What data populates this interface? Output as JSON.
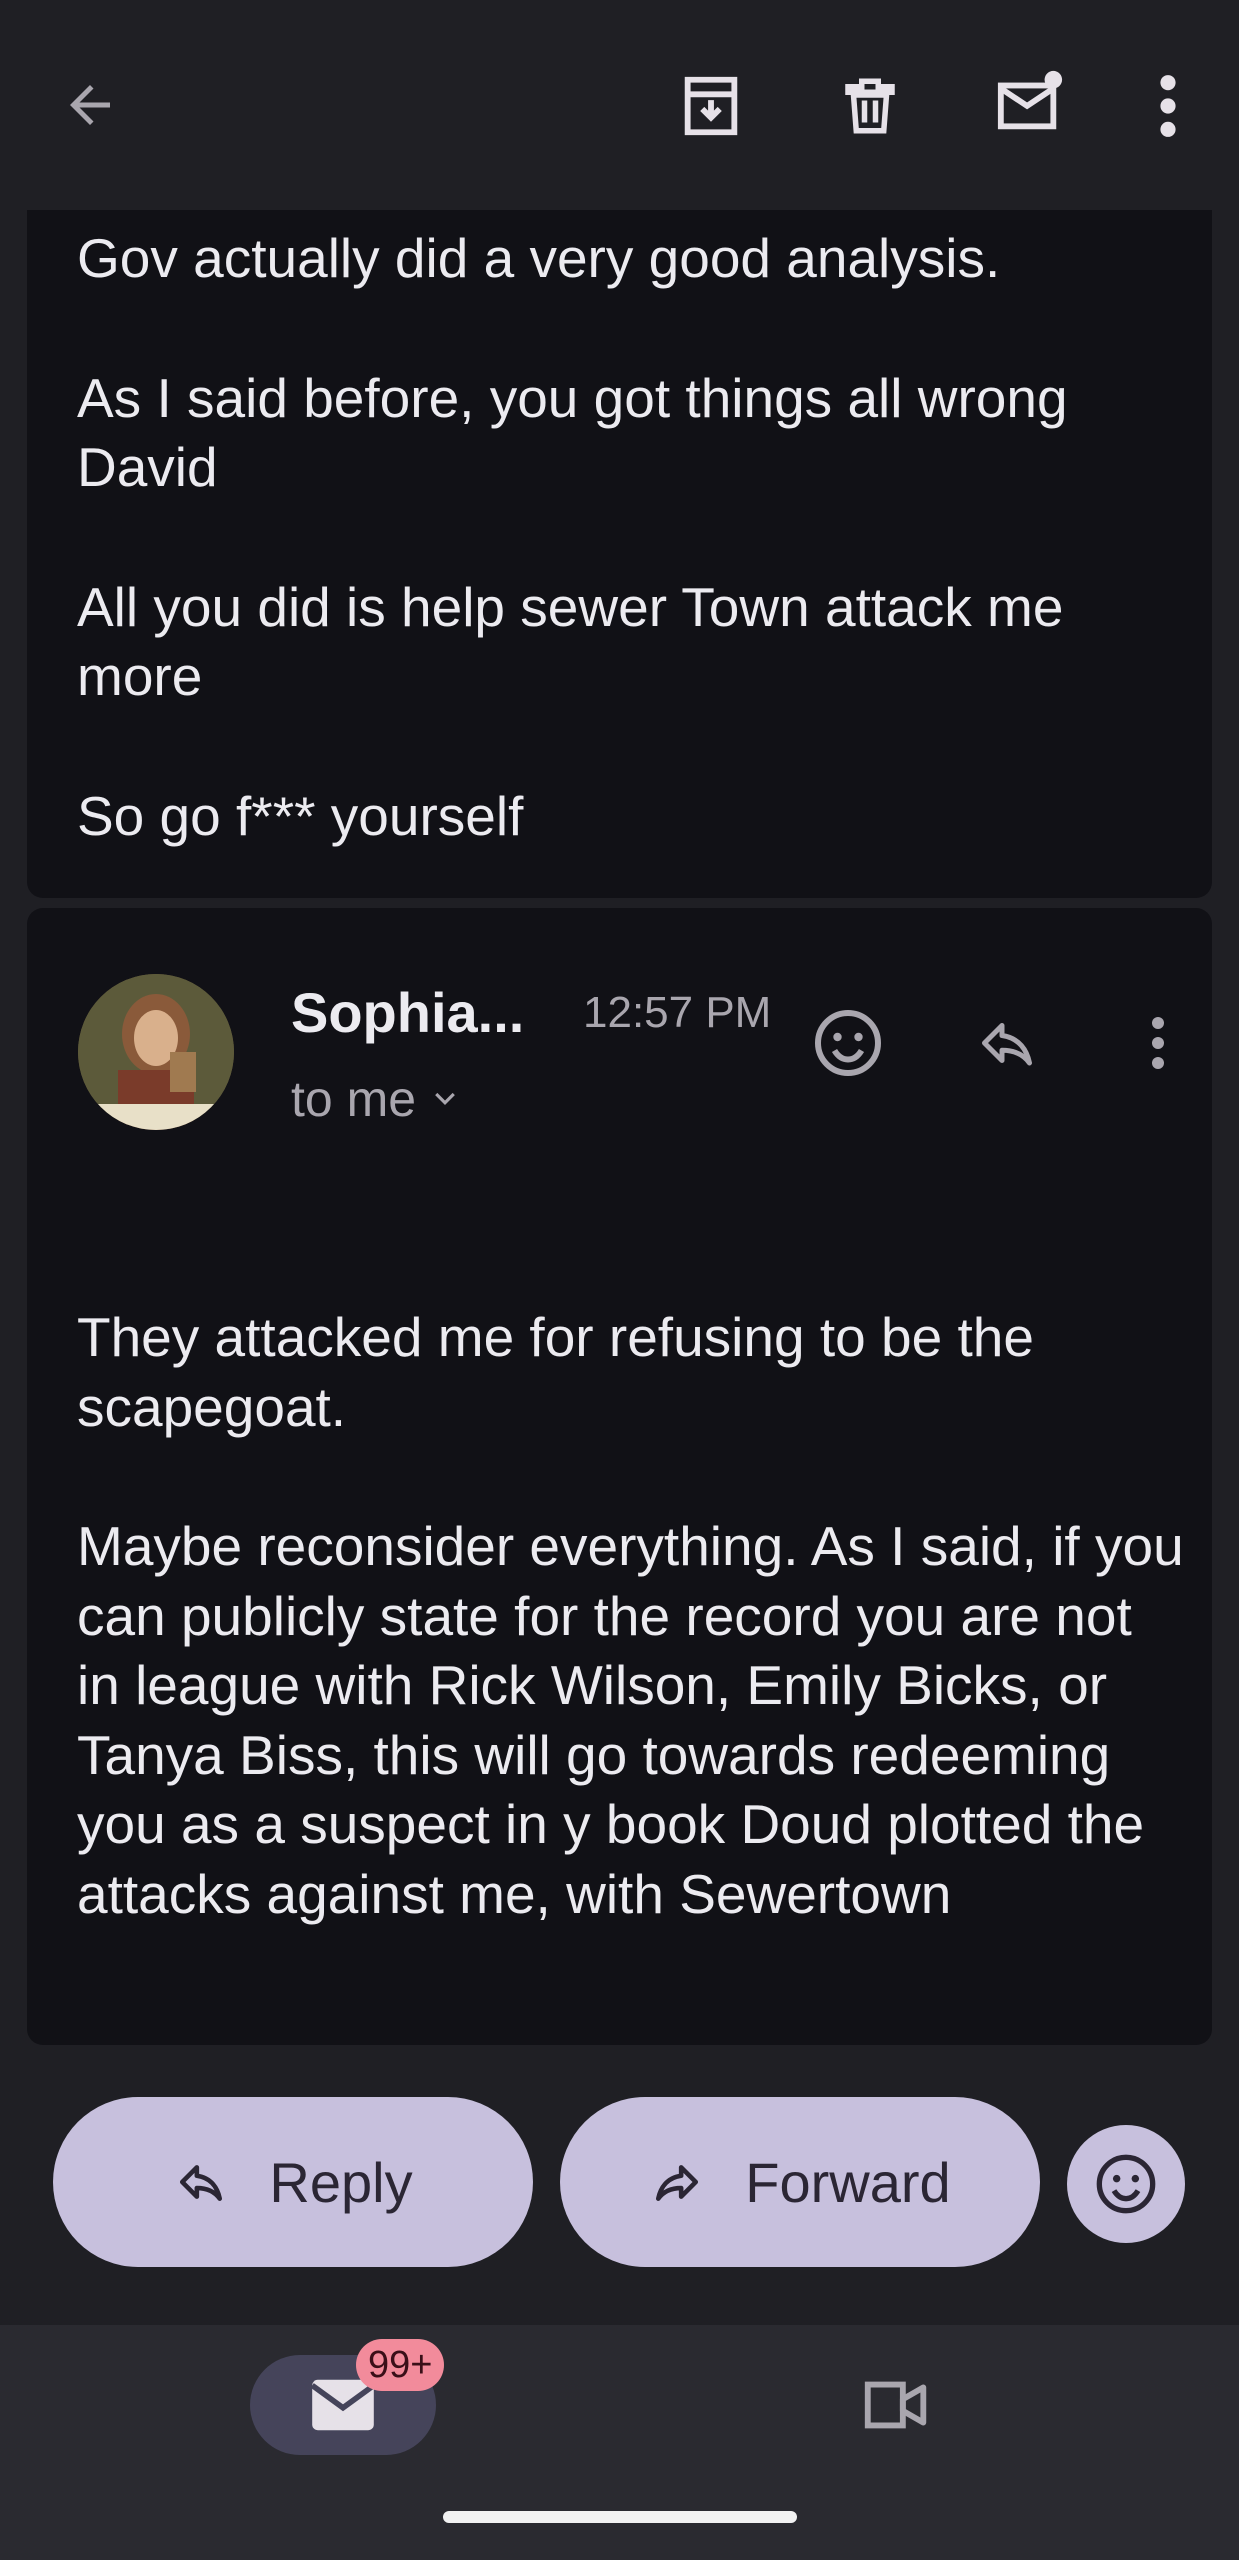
{
  "toolbar": {
    "back_icon": "arrow-left-icon",
    "archive_icon": "archive-icon",
    "delete_icon": "trash-icon",
    "mark_unread_icon": "mail-unread-icon",
    "more_icon": "more-vert-icon"
  },
  "previous_message": {
    "paragraphs": [
      "Gov actually did a very good analysis.",
      "As I said before, you got things all wrong David",
      "All you did is help sewer Town attack me more",
      "So go f*** yourself"
    ]
  },
  "message": {
    "sender": "Sophia...",
    "time": "12:57 PM",
    "recipient": "to me",
    "paragraphs": [
      "They attacked me for refusing to be the scapegoat.",
      "Maybe reconsider everything. As I said, if you can publicly state for the record you are not in league with Rick Wilson, Emily Bicks, or Tanya Biss, this will go towards redeeming you as a suspect in y book Doud plotted the attacks against me, with Sewertown"
    ]
  },
  "actions": {
    "reply_label": "Reply",
    "forward_label": "Forward"
  },
  "bottom_nav": {
    "mail_badge": "99+"
  },
  "colors": {
    "background": "#1f1f24",
    "card": "#111116",
    "pill": "#c7c0dd",
    "badge": "#f28b9b"
  }
}
